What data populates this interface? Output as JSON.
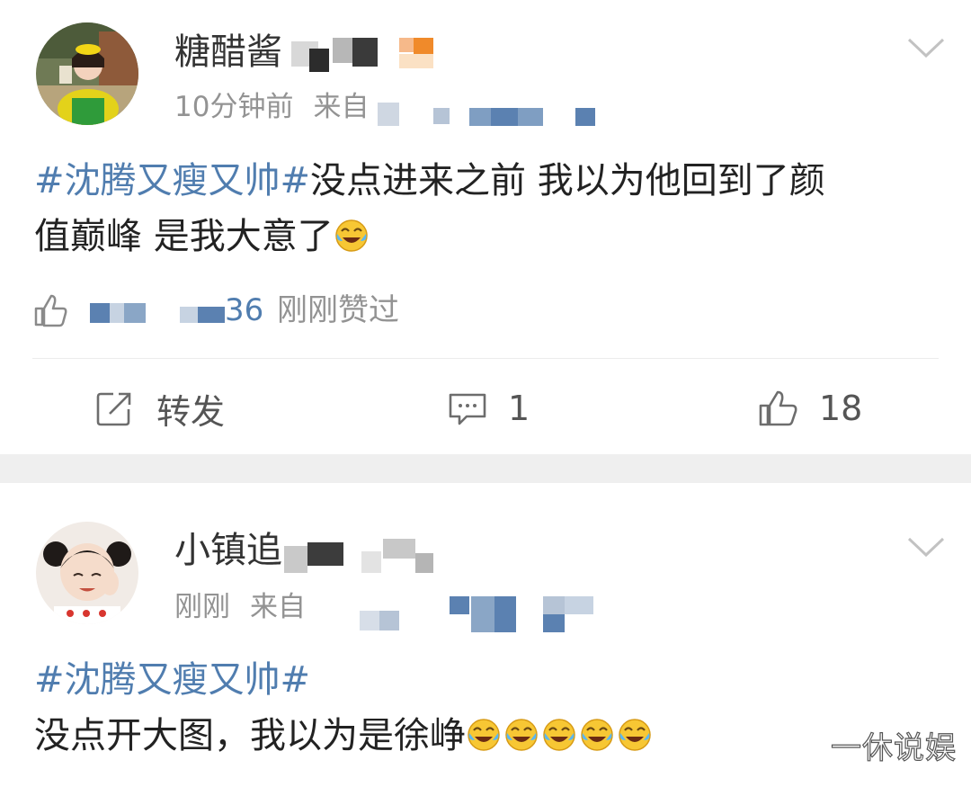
{
  "comments": [
    {
      "username": "糖醋酱",
      "time": "10分钟前",
      "source": "来自",
      "hashtag": "#沈腾又瘦又帅#",
      "text_line1": "没点进来之前 我以为他回到了颜",
      "text_line2": "值巅峰 是我大意了",
      "like_count": "36",
      "like_text": "刚刚赞过",
      "repost_label": "转发",
      "comment_count": "1",
      "like_total": "18",
      "avatar_icon": "avatar-girl-yellow-hat",
      "emoji_icon": "laugh-cry-emoji"
    },
    {
      "username": "小镇追",
      "time": "刚刚",
      "source": "来自",
      "hashtag": "#沈腾又瘦又帅#",
      "text": "没点开大图，我以为是徐峥",
      "avatar_icon": "avatar-child-pigtails",
      "emoji_icon": "laugh-cry-emoji",
      "emoji_count": 5
    }
  ],
  "watermark": "一休说娱",
  "colors": {
    "link": "#507daf",
    "meta": "#939393",
    "text": "#222222",
    "band": "#efefef"
  }
}
